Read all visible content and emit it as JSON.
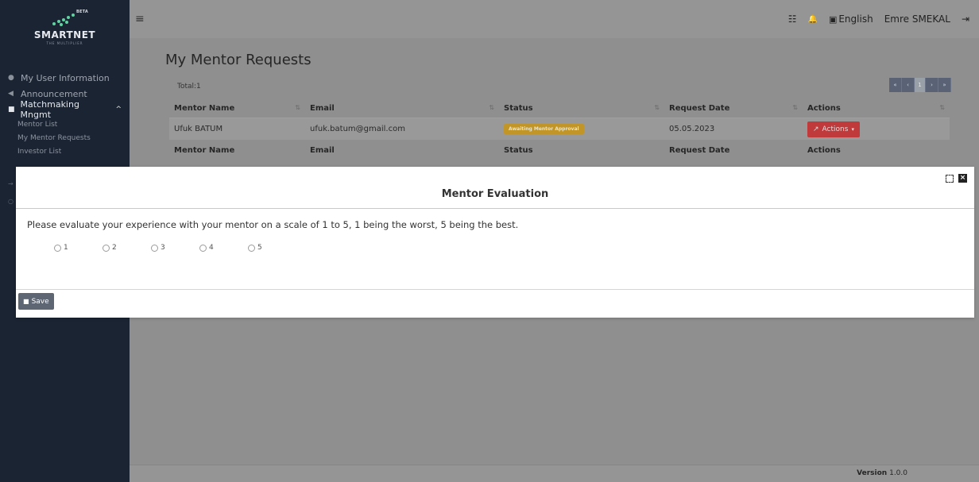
{
  "brand": {
    "beta": "BETA",
    "name": "SMARTNET",
    "tagline": "THE MULTIPLIER"
  },
  "sidebar": {
    "items": [
      {
        "label": "My User Information",
        "icon": "user-icon"
      },
      {
        "label": "Announcement",
        "icon": "megaphone-icon"
      },
      {
        "label": "Matchmaking Mngmt",
        "icon": "briefcase-icon",
        "caret": "^"
      }
    ],
    "subitems": [
      "Mentor List",
      "My Mentor Requests",
      "Investor List"
    ]
  },
  "topbar": {
    "menu_icon": "≡",
    "tasks_icon": "☷",
    "bell_icon": "🔔",
    "language": "English",
    "user": "Emre SMEKAL",
    "logout_icon": "⇥"
  },
  "page": {
    "title": "My Mentor Requests",
    "total": "Total:1",
    "pager": [
      "«",
      "‹",
      "1",
      "›",
      "»"
    ]
  },
  "table": {
    "headers": [
      "Mentor Name",
      "Email",
      "Status",
      "Request Date",
      "Actions"
    ],
    "rows": [
      {
        "mentor_name": "Ufuk BATUM",
        "email": "ufuk.batum@gmail.com",
        "status": "Awaiting Mentor Approval",
        "request_date": "05.05.2023",
        "actions": "Actions"
      }
    ],
    "status_color": "#c19527",
    "actions_color": "#c0393b"
  },
  "modal": {
    "title": "Mentor Evaluation",
    "prompt": "Please evaluate your experience with your mentor on a scale of 1 to 5, 1 being the worst, 5 being the best.",
    "options": [
      "1",
      "2",
      "3",
      "4",
      "5"
    ],
    "save_label": "Save"
  },
  "footer": {
    "version_label": "Version",
    "version": "1.0.0"
  }
}
